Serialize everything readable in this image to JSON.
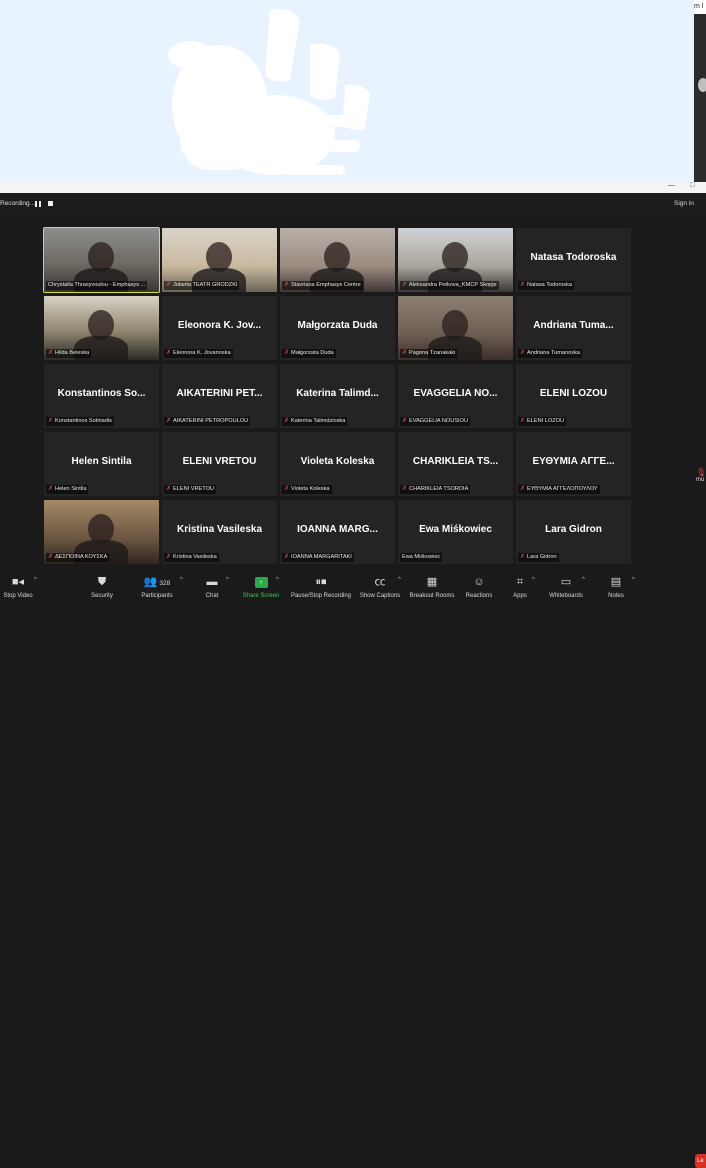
{
  "recording": {
    "status": "Recording..."
  },
  "header": {
    "sign_in": "Sign in",
    "tooltip_fragment": "m l",
    "mini_left": "—",
    "mini_right": "□"
  },
  "colors": {
    "active_speaker_border": "#cde13a",
    "mic_muted": "#e5484d",
    "share_green": "#2ca84a",
    "leave_red": "#d93025"
  },
  "participants": [
    {
      "label": "Chrystalla Thrasyvoulou - Emphasys ...",
      "video": true,
      "muted": false,
      "active": true
    },
    {
      "label": "Jolanta TEATR GRODZKI",
      "video": true,
      "muted": true
    },
    {
      "label": "Stavriana Emphasys Centre",
      "video": true,
      "muted": true
    },
    {
      "label": "Aleksandra Petkova_KMCP Skopje",
      "video": true,
      "muted": true
    },
    {
      "display_name": "Natasa Todoroska",
      "label": "Natasa Todoroska",
      "video": false,
      "muted": true
    },
    {
      "label": "Hilda Beleska",
      "video": true,
      "muted": true
    },
    {
      "display_name": "Eleonora K. Jov...",
      "label": "Eleonora K. Jovanoska",
      "video": false,
      "muted": true
    },
    {
      "display_name": "Małgorzata Duda",
      "label": "Małgorzata Duda",
      "video": false,
      "muted": true
    },
    {
      "label": "Pagona Tzanakaki",
      "video": true,
      "muted": true
    },
    {
      "display_name": "Andriana Tuma...",
      "label": "Andriana Tumanoska",
      "video": false,
      "muted": true
    },
    {
      "display_name": "Konstantinos So...",
      "label": "Konstantinos Sotiriadis",
      "video": false,
      "muted": true
    },
    {
      "display_name": "AIKATERINI PET...",
      "label": "AIKATERINI PETROPOULOU",
      "video": false,
      "muted": true
    },
    {
      "display_name": "Katerina Talimd...",
      "label": "Katerina Talimdzioska",
      "video": false,
      "muted": true
    },
    {
      "display_name": "EVAGGELIA NO...",
      "label": "EVAGGELIA NOUSIOU",
      "video": false,
      "muted": true
    },
    {
      "display_name": "ELENI LOZOU",
      "label": "ELENI LOZOU",
      "video": false,
      "muted": true
    },
    {
      "display_name": "Helen Sintila",
      "label": "Helen Sintila",
      "video": false,
      "muted": true
    },
    {
      "display_name": "ELENI VRETOU",
      "label": "ELENI VRETOU",
      "video": false,
      "muted": true
    },
    {
      "display_name": "Violeta Koleska",
      "label": "Violeta Koleska",
      "video": false,
      "muted": true
    },
    {
      "display_name": "CHARIKLEIA TS...",
      "label": "CHARIKLEIA TSORDIA",
      "video": false,
      "muted": true
    },
    {
      "display_name": "ΕΥΘΥΜΙΑ ΑΓΓΕ...",
      "label": "ΕΥΘΥΜΙΑ ΑΓΓΕΛΟΠΟΥΛΟΥ",
      "video": false,
      "muted": true
    },
    {
      "label": "ΔΕΣΠΟΙΝΑ ΚΟΥΣΚΑ",
      "video": true,
      "muted": true
    },
    {
      "display_name": "Kristina Vasileska",
      "label": "Kristina Vasileska",
      "video": false,
      "muted": true
    },
    {
      "display_name": "IOANNA MARG...",
      "label": "IOANNA MARGARITAKI",
      "video": false,
      "muted": true
    },
    {
      "display_name": "Ewa Miśkowiec",
      "label": "Ewa Miśkowiec",
      "video": false,
      "muted": false
    },
    {
      "display_name": "Lara Gidron",
      "label": "Lara Gidron",
      "video": false,
      "muted": true
    }
  ],
  "side_chip": {
    "text": "mu"
  },
  "toolbar": {
    "stop_video": "Stop Video",
    "security": "Security",
    "participants": "Participants",
    "participant_count": "328",
    "chat": "Chat",
    "share_screen": "Share Screen",
    "recording": "Pause/Stop Recording",
    "captions": "Show Captions",
    "breakout": "Breakout Rooms",
    "reactions": "Reactions",
    "apps": "Apps",
    "whiteboards": "Whiteboards",
    "notes": "Notes",
    "leave": "Le"
  }
}
